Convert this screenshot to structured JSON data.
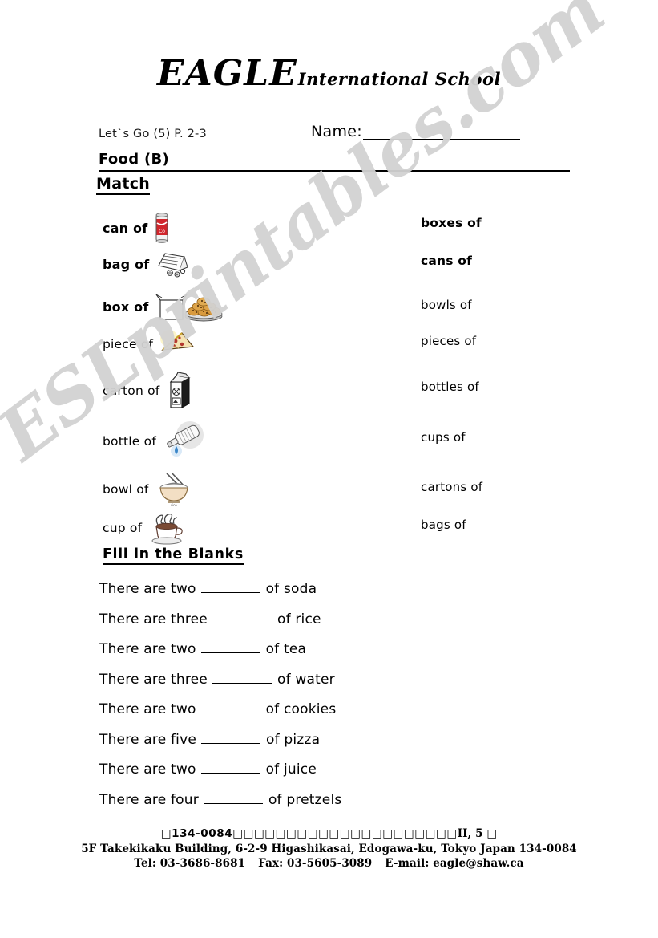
{
  "header": {
    "school_name_main": "EAGLE",
    "school_name_rest": "International  School",
    "book_reference": "Let`s Go (5) P. 2-3",
    "name_label": "Name:",
    "unit_title": "Food (B)"
  },
  "sections": {
    "match_title": "Match",
    "fill_title": "Fill in the Blanks"
  },
  "match": {
    "left_column": [
      {
        "label": "can of",
        "icon": "soda-can-image",
        "bold": true
      },
      {
        "label": "bag of",
        "icon": "pretzel-bag-image",
        "bold": true
      },
      {
        "label": "box of",
        "icon": "box-cookies-image",
        "bold": true
      },
      {
        "label": "piece of",
        "icon": "pizza-slice-image",
        "bold": false
      },
      {
        "label": "carton of",
        "icon": "milk-carton-image",
        "bold": false
      },
      {
        "label": "bottle of",
        "icon": "water-bottle-image",
        "bold": false
      },
      {
        "label": "bowl of",
        "icon": "rice-bowl-image",
        "bold": false
      },
      {
        "label": "cup of",
        "icon": "tea-cup-image",
        "bold": false
      }
    ],
    "right_column": [
      {
        "label": "boxes of",
        "bold": true
      },
      {
        "label": "cans of",
        "bold": true
      },
      {
        "label": "bowls of",
        "bold": false
      },
      {
        "label": "pieces of",
        "bold": false
      },
      {
        "label": "bottles of",
        "bold": false
      },
      {
        "label": "cups of",
        "bold": false
      },
      {
        "label": "cartons of",
        "bold": false
      },
      {
        "label": "bags of",
        "bold": false
      }
    ]
  },
  "fill_in_blanks": [
    {
      "prefix": "There are two",
      "suffix": "of soda"
    },
    {
      "prefix": "There are three",
      "suffix": "of rice"
    },
    {
      "prefix": "There are two",
      "suffix": "of tea"
    },
    {
      "prefix": "There are three",
      "suffix": "of water"
    },
    {
      "prefix": "There are two",
      "suffix": "of cookies"
    },
    {
      "prefix": "There are five",
      "suffix": "of pizza"
    },
    {
      "prefix": "There are two",
      "suffix": "of juice"
    },
    {
      "prefix": "There are four",
      "suffix": "of pretzels"
    }
  ],
  "watermark": {
    "text": "ESLprintables.com",
    "color": "#d2d2d2"
  },
  "footer": {
    "line1_postal": "□134-0084",
    "line1_jp": "□□□□□□□□□□□□□□□□□□□□□",
    "line1_suffix": "II, 5 □",
    "line2": "5F Takekikaku Building, 6-2-9 Higashikasai, Edogawa-ku, Tokyo Japan 134-0084",
    "tel": "Tel: 03-3686-8681",
    "fax": "Fax: 03-5605-3089",
    "email": "E-mail: eagle@shaw.ca"
  }
}
